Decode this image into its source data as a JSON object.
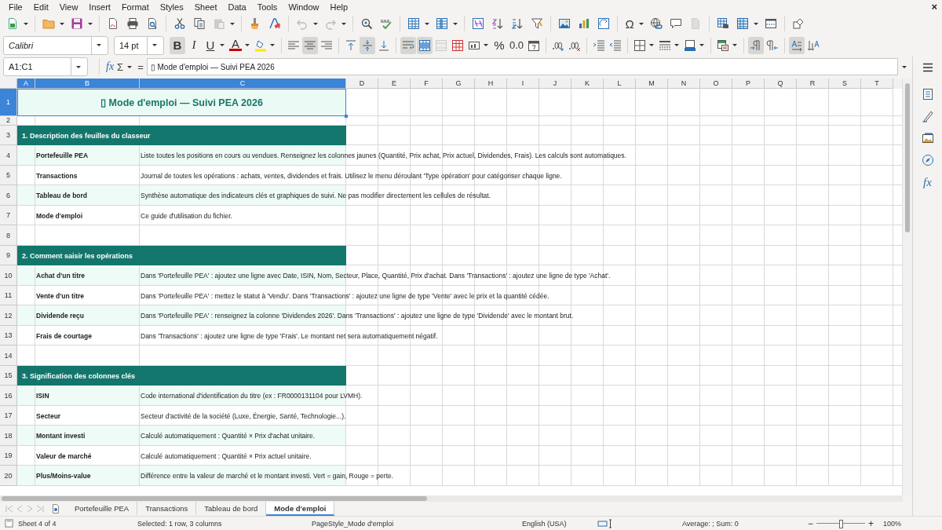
{
  "menu": [
    "File",
    "Edit",
    "View",
    "Insert",
    "Format",
    "Styles",
    "Sheet",
    "Data",
    "Tools",
    "Window",
    "Help"
  ],
  "close_document": "×",
  "special_character": "Ω",
  "font": {
    "name": "Calibri",
    "size": "14 pt"
  },
  "format_buttons": [
    {
      "kind": "bold",
      "label": "B",
      "on": true
    },
    {
      "kind": "italic",
      "label": "I",
      "on": false
    },
    {
      "kind": "underline",
      "label": "U",
      "on": false
    },
    {
      "kind": "font-color",
      "label": "A",
      "on": false
    },
    {
      "kind": "highlight",
      "on": false
    },
    {
      "kind": "align-left",
      "on": false
    },
    {
      "kind": "align-center",
      "on": true
    },
    {
      "kind": "align-right",
      "on": false
    },
    {
      "kind": "align-top",
      "on": false
    },
    {
      "kind": "align-middle",
      "on": true
    },
    {
      "kind": "align-bottom",
      "on": false
    },
    {
      "kind": "wrap-text",
      "on": true
    },
    {
      "kind": "merge-center",
      "on": true
    },
    {
      "kind": "merge-cells",
      "on": false
    },
    {
      "kind": "unmerge-cells",
      "on": false
    },
    {
      "kind": "number-format",
      "on": false
    },
    {
      "kind": "percent",
      "label": "%",
      "on": false
    },
    {
      "kind": "decimal",
      "label": "0.0",
      "on": false
    },
    {
      "kind": "date",
      "on": false
    },
    {
      "kind": "add-decimal",
      "on": false
    },
    {
      "kind": "delete-decimal",
      "on": false
    },
    {
      "kind": "indent",
      "on": false
    },
    {
      "kind": "outdent",
      "on": false
    },
    {
      "kind": "borders",
      "on": false
    },
    {
      "kind": "border-style",
      "on": false
    },
    {
      "kind": "border-color",
      "on": false
    },
    {
      "kind": "conditional-format",
      "on": false
    },
    {
      "kind": "paragraph-ltr",
      "on": true
    },
    {
      "kind": "paragraph-rtl",
      "on": false
    },
    {
      "kind": "text-ltr",
      "on": true
    },
    {
      "kind": "text-ttb",
      "on": false
    }
  ],
  "formula_bar": {
    "name_box": "A1:C1",
    "wizard": "fx",
    "sum": "Σ",
    "equals": "=",
    "content": "▯ Mode d'emploi — Suivi PEA 2026"
  },
  "columns": [
    {
      "label": "A",
      "selected": true
    },
    {
      "label": "B",
      "selected": true
    },
    {
      "label": "C",
      "selected": true
    },
    {
      "label": "D",
      "selected": false
    },
    {
      "label": "E",
      "selected": false
    },
    {
      "label": "F",
      "selected": false
    },
    {
      "label": "G",
      "selected": false
    },
    {
      "label": "H",
      "selected": false
    },
    {
      "label": "I",
      "selected": false
    },
    {
      "label": "J",
      "selected": false
    },
    {
      "label": "K",
      "selected": false
    },
    {
      "label": "L",
      "selected": false
    },
    {
      "label": "M",
      "selected": false
    },
    {
      "label": "N",
      "selected": false
    },
    {
      "label": "O",
      "selected": false
    },
    {
      "label": "P",
      "selected": false
    },
    {
      "label": "Q",
      "selected": false
    },
    {
      "label": "R",
      "selected": false
    },
    {
      "label": "S",
      "selected": false
    },
    {
      "label": "T",
      "selected": false
    }
  ],
  "rows": [
    {
      "number": "1",
      "selected": true,
      "kind": "title",
      "text": "▯ Mode d'emploi — Suivi PEA 2026"
    },
    {
      "number": "2",
      "selected": false,
      "kind": "gap"
    },
    {
      "number": "3",
      "selected": false,
      "kind": "section",
      "text": "1. Description des feuilles du classeur"
    },
    {
      "number": "4",
      "selected": false,
      "kind": "item",
      "shaded": true,
      "label": "Portefeuille PEA",
      "description": "Liste toutes les positions en cours ou vendues. Renseignez les colonnes jaunes (Quantité, Prix achat, Prix actuel, Dividendes, Frais). Les calculs sont automatiques."
    },
    {
      "number": "5",
      "selected": false,
      "kind": "item",
      "shaded": false,
      "label": "Transactions",
      "description": "Journal de toutes les opérations : achats, ventes, dividendes et frais. Utilisez le menu déroulant 'Type opération' pour catégoriser chaque ligne."
    },
    {
      "number": "6",
      "selected": false,
      "kind": "item",
      "shaded": true,
      "label": "Tableau de bord",
      "description": "Synthèse automatique des indicateurs clés et graphiques de suivi. Ne pas modifier directement les cellules de résultat."
    },
    {
      "number": "7",
      "selected": false,
      "kind": "item",
      "shaded": false,
      "label": "Mode d'emploi",
      "description": "Ce guide d'utilisation du fichier."
    },
    {
      "number": "8",
      "selected": false,
      "kind": "blank"
    },
    {
      "number": "9",
      "selected": false,
      "kind": "section",
      "text": "2. Comment saisir les opérations"
    },
    {
      "number": "10",
      "selected": false,
      "kind": "item",
      "shaded": true,
      "label": "Achat d'un titre",
      "description": "Dans 'Portefeuille PEA' : ajoutez une ligne avec Date, ISIN, Nom, Secteur, Place, Quantité, Prix d'achat. Dans 'Transactions' : ajoutez une ligne de type 'Achat'."
    },
    {
      "number": "11",
      "selected": false,
      "kind": "item",
      "shaded": false,
      "label": "Vente d'un titre",
      "description": "Dans 'Portefeuille PEA' : mettez le statut à 'Vendu'. Dans 'Transactions' : ajoutez une ligne de type 'Vente' avec le prix et la quantité cédée."
    },
    {
      "number": "12",
      "selected": false,
      "kind": "item",
      "shaded": true,
      "label": "Dividende reçu",
      "description": "Dans 'Portefeuille PEA' : renseignez la colonne 'Dividendes 2026'. Dans 'Transactions' : ajoutez une ligne de type 'Dividende' avec le montant brut."
    },
    {
      "number": "13",
      "selected": false,
      "kind": "item",
      "shaded": false,
      "label": "Frais de courtage",
      "description": "Dans 'Transactions' : ajoutez une ligne de type 'Frais'. Le montant net sera automatiquement négatif."
    },
    {
      "number": "14",
      "selected": false,
      "kind": "blank"
    },
    {
      "number": "15",
      "selected": false,
      "kind": "section",
      "text": "3. Signification des colonnes clés"
    },
    {
      "number": "16",
      "selected": false,
      "kind": "item",
      "shaded": true,
      "label": "ISIN",
      "description": "Code international d'identification du titre (ex : FR0000131104 pour LVMH)."
    },
    {
      "number": "17",
      "selected": false,
      "kind": "item",
      "shaded": false,
      "label": "Secteur",
      "description": "Secteur d'activité de la société (Luxe, Énergie, Santé, Technologie...)."
    },
    {
      "number": "18",
      "selected": false,
      "kind": "item",
      "shaded": true,
      "label": "Montant investi",
      "description": "Calculé automatiquement : Quantité × Prix d'achat unitaire."
    },
    {
      "number": "19",
      "selected": false,
      "kind": "item",
      "shaded": false,
      "label": "Valeur de marché",
      "description": "Calculé automatiquement : Quantité × Prix actuel unitaire."
    },
    {
      "number": "20",
      "selected": false,
      "kind": "item",
      "shaded": true,
      "label": "Plus/Moins-value",
      "description": "Différence entre la valeur de marché et le montant investi. Vert = gain, Rouge = perte."
    }
  ],
  "sheet_tabs": [
    {
      "label": "Portefeuille PEA",
      "selected": false
    },
    {
      "label": "Transactions",
      "selected": false
    },
    {
      "label": "Tableau de bord",
      "selected": false
    },
    {
      "label": "Mode d'emploi",
      "selected": true
    }
  ],
  "sidebar": {
    "functions": "fx"
  },
  "status_bar": {
    "sheet": "Sheet 4 of 4",
    "selection": "Selected: 1 row, 3 columns",
    "page_style": "PageStyle_Mode d'emploi",
    "language": "English (USA)",
    "summary": "Average: ; Sum: 0",
    "zoom_out": "−",
    "zoom_in": "+",
    "zoom": {
      "level": 0.5
    },
    "zoom_percent": "100%"
  }
}
